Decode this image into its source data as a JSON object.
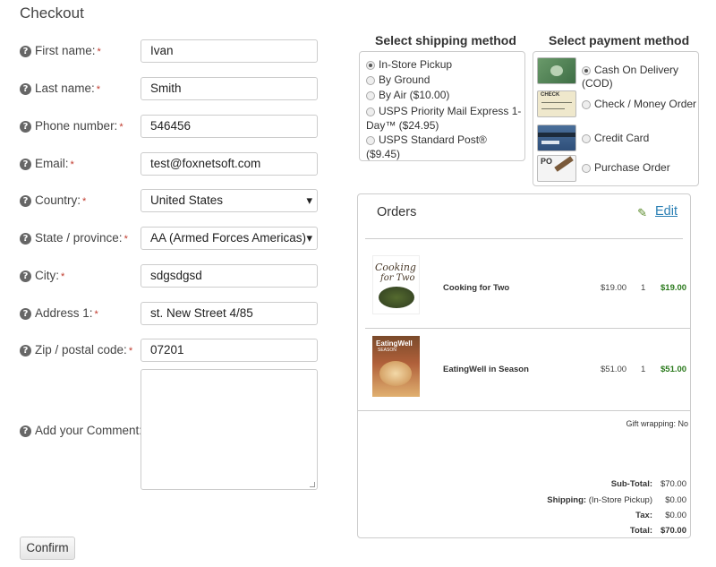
{
  "page": {
    "title": "Checkout"
  },
  "form": {
    "fields": [
      {
        "label": "First name:",
        "required": "*",
        "value": "Ivan"
      },
      {
        "label": "Last name:",
        "required": "*",
        "value": "Smith"
      },
      {
        "label": "Phone number:",
        "required": "*",
        "value": "546456"
      },
      {
        "label": "Email:",
        "required": "*",
        "value": "test@foxnetsoft.com"
      },
      {
        "label": "Country:",
        "required": "*",
        "value": "United States"
      },
      {
        "label": "State / province:",
        "required": "*",
        "value": "AA (Armed Forces Americas)"
      },
      {
        "label": "City:",
        "required": "*",
        "value": "sdgsdgsd"
      },
      {
        "label": "Address 1:",
        "required": "*",
        "value": "st. New Street 4/85"
      },
      {
        "label": "Zip / postal code:",
        "required": "*",
        "value": "07201"
      }
    ],
    "comment_label": "Add your Comment:",
    "comment_value": "",
    "help_glyph": "?",
    "confirm_label": "Confirm"
  },
  "shipping": {
    "heading": "Select shipping method",
    "options": [
      {
        "label": "In-Store Pickup",
        "checked": true
      },
      {
        "label": "By Ground",
        "checked": false
      },
      {
        "label": "By Air ($10.00)",
        "checked": false
      },
      {
        "label": "USPS Priority Mail Express 1-Day™ ($24.95)",
        "checked": false
      },
      {
        "label": "USPS Standard Post® ($9.45)",
        "checked": false
      }
    ]
  },
  "payment": {
    "heading": "Select payment method",
    "options": [
      {
        "label": "Cash On Delivery (COD)",
        "checked": true,
        "icon": "cash-icon"
      },
      {
        "label": "Check / Money Order",
        "checked": false,
        "icon": "check-icon"
      },
      {
        "label": "Credit Card",
        "checked": false,
        "icon": "credit-card-icon"
      },
      {
        "label": "Purchase Order",
        "checked": false,
        "icon": "purchase-order-icon",
        "icon_text": "PO"
      }
    ],
    "check_icon_text": "CHECK"
  },
  "orders": {
    "title": "Orders",
    "edit_label": "Edit",
    "items": [
      {
        "name": "Cooking for Two",
        "price": "$19.00",
        "qty": "1",
        "total": "$19.00",
        "cover_title": "Cooking",
        "cover_sub": "for Two"
      },
      {
        "name": "EatingWell in Season",
        "price": "$51.00",
        "qty": "1",
        "total": "$51.00",
        "cover_title": "EatingWell",
        "cover_sub": "SEASON"
      }
    ],
    "gift_wrapping": "Gift wrapping: No",
    "summary": {
      "subtotal_label": "Sub-Total:",
      "subtotal": "$70.00",
      "shipping_label": "Shipping:",
      "shipping_note": "(In-Store Pickup)",
      "shipping": "$0.00",
      "tax_label": "Tax:",
      "tax": "$0.00",
      "total_label": "Total:",
      "total": "$70.00"
    }
  },
  "colors": {
    "accent_link": "#2a7fb4",
    "price_green": "#2b7a1d",
    "required": "#c0392b"
  }
}
